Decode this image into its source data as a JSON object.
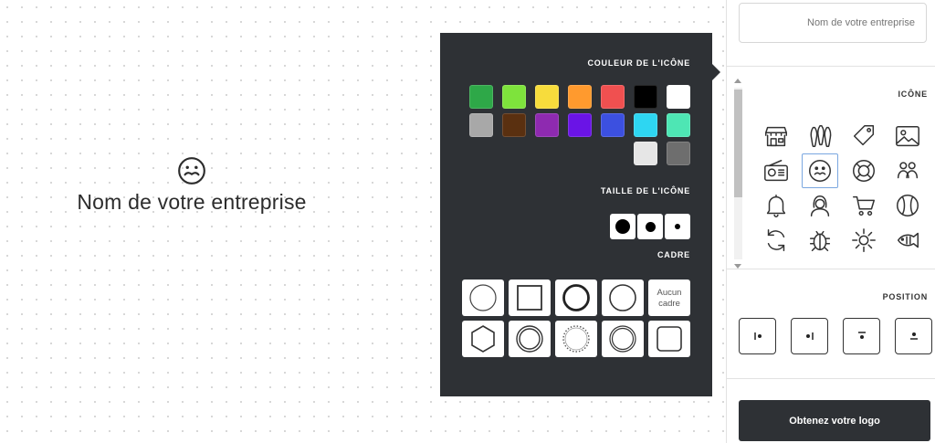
{
  "preview": {
    "company_name": "Nom de votre entreprise",
    "icon": "mustache-face-icon"
  },
  "popover": {
    "color_title": "COULEUR DE L'ICÔNE",
    "size_title": "TAILLE DE L'ICÔNE",
    "frame_title": "CADRE",
    "colors": [
      "#ffffff",
      "#000000",
      "#f05050",
      "#ff9a2e",
      "#f7dc3c",
      "#7ee33c",
      "#2ea848",
      "#4ee6b4",
      "#2ed6f2",
      "#3c50e0",
      "#6a14e6",
      "#8e2ab0",
      "#5a3010",
      "#a8a8a8",
      "#6e6e6e",
      "#e6e6e6"
    ],
    "sizes": [
      "small",
      "medium",
      "large"
    ],
    "frames": [
      "none",
      "circle",
      "circle-bold",
      "square",
      "circle-thin",
      "square-rounded",
      "circle-double",
      "circle-dotted",
      "circle-ring",
      "hexagon"
    ],
    "no_frame_label": "Aucun cadre"
  },
  "sidebar": {
    "company_placeholder": "Nom de votre entreprise",
    "icon_title": "ICÔNE",
    "icons": [
      "picture-icon",
      "tag-icon",
      "bowling-icon",
      "storefront-icon",
      "people-icon",
      "lifebuoy-icon",
      "mustache-face-icon",
      "radio-icon",
      "baseball-icon",
      "cart-icon",
      "woman-icon",
      "bell-icon",
      "fish-icon",
      "sun-icon",
      "bug-icon",
      "refresh-icon"
    ],
    "selected_icon": "mustache-face-icon",
    "position_title": "POSITION",
    "positions": [
      "icon-top",
      "icon-middle",
      "icon-left",
      "icon-right"
    ],
    "cta_label": "Obtenez votre logo"
  }
}
